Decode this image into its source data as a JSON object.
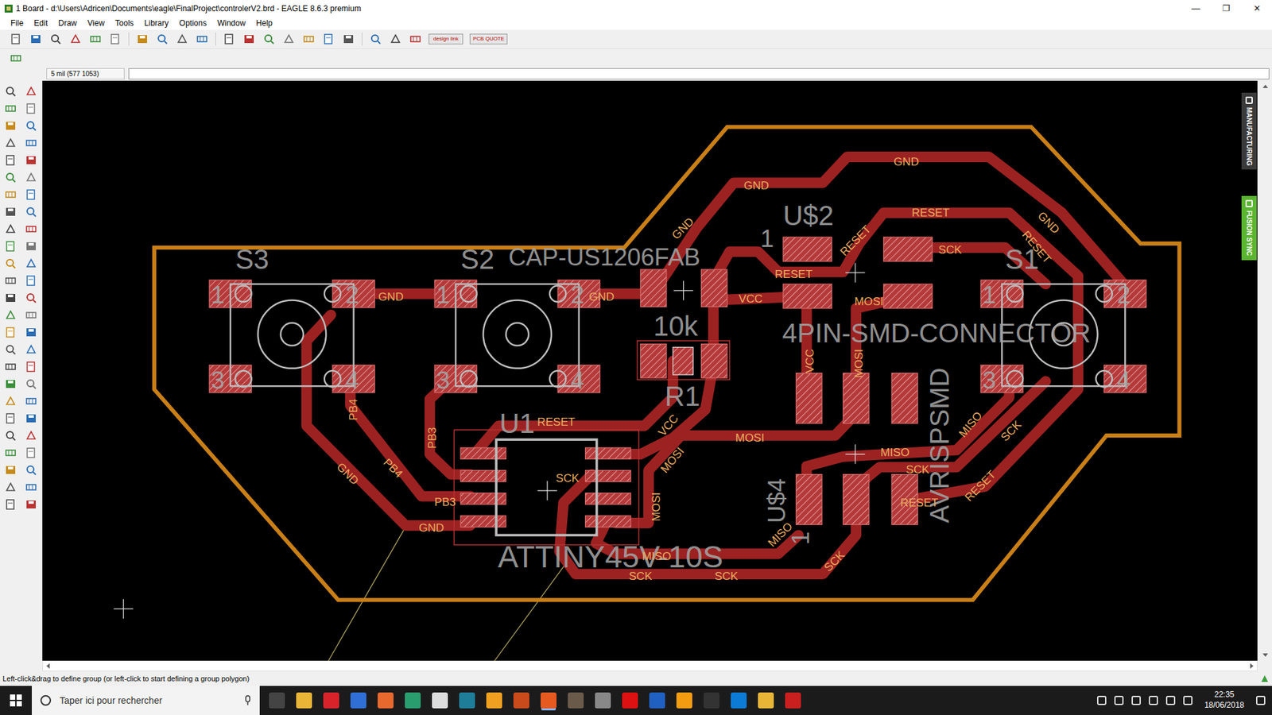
{
  "window": {
    "title": "1 Board - d:\\Users\\Adricen\\Documents\\eagle\\FinalProject\\controlerV2.brd - EAGLE 8.6.3 premium",
    "controls": [
      "—",
      "❐",
      "✕"
    ]
  },
  "menu": [
    "File",
    "Edit",
    "Draw",
    "View",
    "Tools",
    "Library",
    "Options",
    "Window",
    "Help"
  ],
  "toolbar": {
    "buttons": [
      "design link",
      "PCB QUOTE"
    ]
  },
  "command": {
    "grid": "5 mil (577 1053)",
    "value": ""
  },
  "side_tabs": [
    {
      "label": "MANUFACTURING",
      "color": "#3a3a3a"
    },
    {
      "label": "FUSION SYNC",
      "color": "#5bb531"
    }
  ],
  "board": {
    "labels": [
      {
        "text": "S3",
        "kind": "part"
      },
      {
        "text": "S2",
        "kind": "part"
      },
      {
        "text": "CAP-US1206FAB",
        "kind": "part"
      },
      {
        "text": "U$2",
        "kind": "part"
      },
      {
        "text": "1",
        "kind": "part"
      },
      {
        "text": "S1",
        "kind": "part"
      },
      {
        "text": "10k",
        "kind": "part"
      },
      {
        "text": "4PIN-SMD-CONNECTOR",
        "kind": "part"
      },
      {
        "text": "R1",
        "kind": "part"
      },
      {
        "text": "U1",
        "kind": "part"
      },
      {
        "text": "ATTINY45V-10S",
        "kind": "part"
      },
      {
        "text": "AVRISPSMD",
        "kind": "part"
      },
      {
        "text": "U$4",
        "kind": "part"
      },
      {
        "text": "1",
        "kind": "part"
      },
      {
        "text": "1",
        "kind": "pin"
      },
      {
        "text": "2",
        "kind": "pin"
      },
      {
        "text": "3",
        "kind": "pin"
      },
      {
        "text": "4",
        "kind": "pin"
      },
      {
        "text": "1",
        "kind": "pin"
      },
      {
        "text": "2",
        "kind": "pin"
      },
      {
        "text": "3",
        "kind": "pin"
      },
      {
        "text": "4",
        "kind": "pin"
      },
      {
        "text": "1",
        "kind": "pin"
      },
      {
        "text": "2",
        "kind": "pin"
      },
      {
        "text": "3",
        "kind": "pin"
      },
      {
        "text": "4",
        "kind": "pin"
      },
      {
        "text": "GND",
        "kind": "net"
      },
      {
        "text": "GND",
        "kind": "net"
      },
      {
        "text": "GND",
        "kind": "net"
      },
      {
        "text": "GND",
        "kind": "net"
      },
      {
        "text": "GND",
        "kind": "net"
      },
      {
        "text": "GND",
        "kind": "net"
      },
      {
        "text": "GND",
        "kind": "net"
      },
      {
        "text": "GND",
        "kind": "net"
      },
      {
        "text": "RESET",
        "kind": "net"
      },
      {
        "text": "RESET",
        "kind": "net"
      },
      {
        "text": "RESET",
        "kind": "net"
      },
      {
        "text": "RESET",
        "kind": "net"
      },
      {
        "text": "RESET",
        "kind": "net"
      },
      {
        "text": "RESET",
        "kind": "net"
      },
      {
        "text": "RESET",
        "kind": "net"
      },
      {
        "text": "VCC",
        "kind": "net"
      },
      {
        "text": "VCC",
        "kind": "net"
      },
      {
        "text": "VCC",
        "kind": "net"
      },
      {
        "text": "SCK",
        "kind": "net"
      },
      {
        "text": "SCK",
        "kind": "net"
      },
      {
        "text": "SCK",
        "kind": "net"
      },
      {
        "text": "SCK",
        "kind": "net"
      },
      {
        "text": "SCK",
        "kind": "net"
      },
      {
        "text": "SCK",
        "kind": "net"
      },
      {
        "text": "SCK",
        "kind": "net"
      },
      {
        "text": "MOSI",
        "kind": "net"
      },
      {
        "text": "MOSI",
        "kind": "net"
      },
      {
        "text": "MOSI",
        "kind": "net"
      },
      {
        "text": "MOSI",
        "kind": "net"
      },
      {
        "text": "MOSI",
        "kind": "net"
      },
      {
        "text": "MISO",
        "kind": "net"
      },
      {
        "text": "MISO",
        "kind": "net"
      },
      {
        "text": "MISO",
        "kind": "net"
      },
      {
        "text": "MISO",
        "kind": "net"
      },
      {
        "text": "PB3",
        "kind": "net"
      },
      {
        "text": "PB3",
        "kind": "net"
      },
      {
        "text": "PB4",
        "kind": "net"
      },
      {
        "text": "PB4",
        "kind": "net"
      }
    ]
  },
  "status_bar": "Left-click&drag to define group (or left-click to start defining a group polygon)",
  "taskbar": {
    "search": "Taper ici pour rechercher",
    "time": "22:35",
    "date": "18/06/2018"
  }
}
